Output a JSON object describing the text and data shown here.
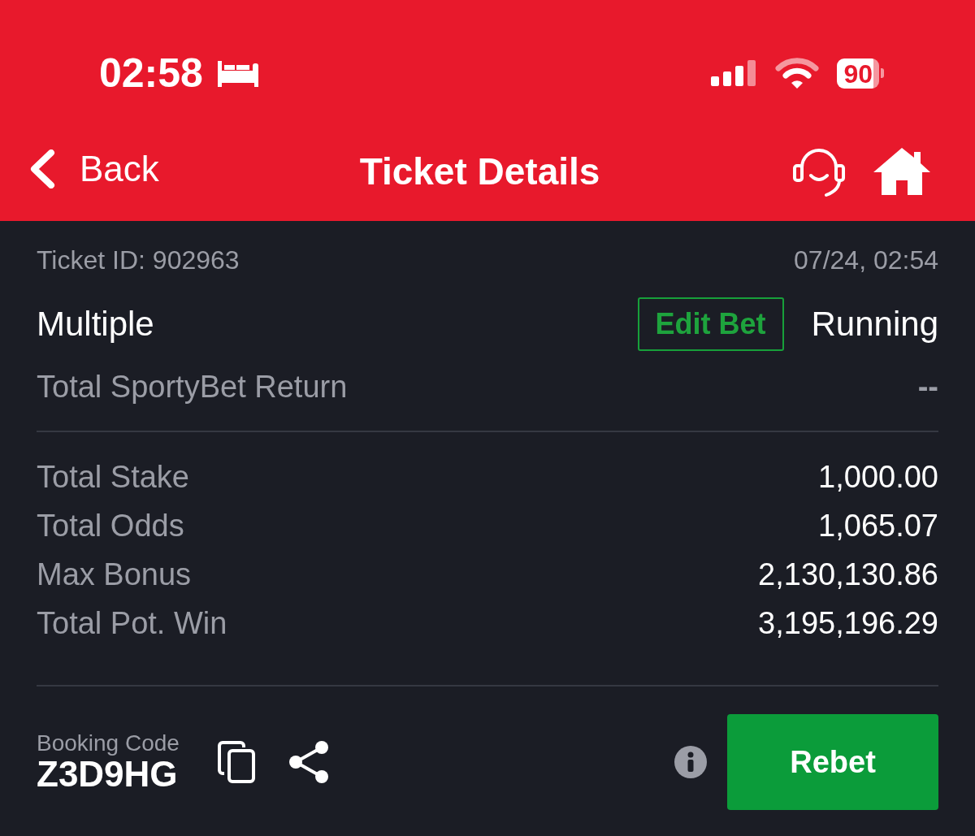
{
  "status_bar": {
    "time": "02:58",
    "battery": "90"
  },
  "nav": {
    "back": "Back",
    "title": "Ticket Details"
  },
  "ticket": {
    "id_label": "Ticket ID: 902963",
    "datetime": "07/24, 02:54",
    "type": "Multiple",
    "edit_button": "Edit Bet",
    "status": "Running",
    "return_label": "Total SportyBet Return",
    "return_value": "--"
  },
  "summary": [
    {
      "label": "Total Stake",
      "value": "1,000.00"
    },
    {
      "label": "Total Odds",
      "value": "1,065.07"
    },
    {
      "label": "Max Bonus",
      "value": "2,130,130.86"
    },
    {
      "label": "Total Pot. Win",
      "value": "3,195,196.29"
    }
  ],
  "booking": {
    "label": "Booking Code",
    "code": "Z3D9HG"
  },
  "rebet_button": "Rebet"
}
